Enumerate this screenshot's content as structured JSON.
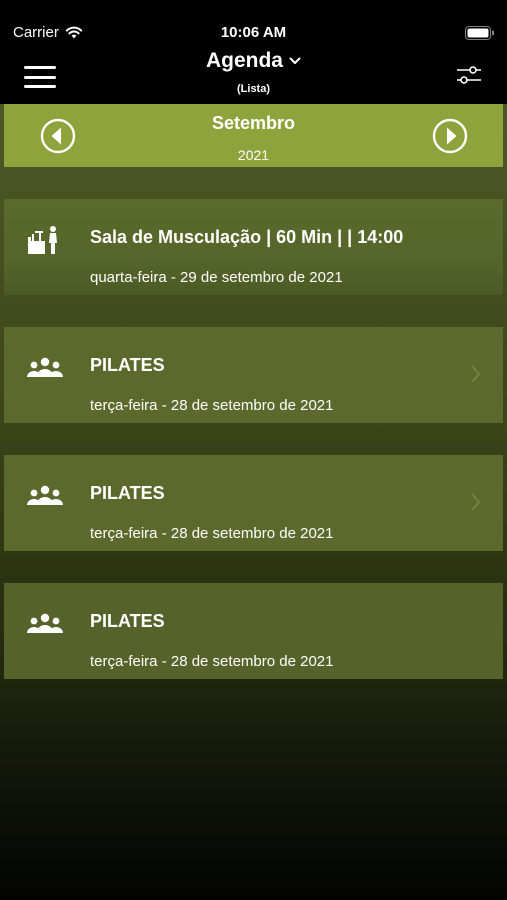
{
  "status": {
    "carrier": "Carrier",
    "time": "10:06 AM",
    "wifi_icon": "wifi-icon",
    "battery_icon": "battery-icon"
  },
  "nav": {
    "title": "Agenda",
    "subtitle": "(Lista)",
    "menu_icon": "hamburger-menu-icon",
    "filter_icon": "sliders-icon",
    "dropdown_icon": "chevron-down-icon"
  },
  "month": {
    "name": "Setembro",
    "year": "2021",
    "prev_icon": "arrow-left-circle-icon",
    "next_icon": "arrow-right-circle-icon"
  },
  "colors": {
    "accent": "#8fa33d",
    "card": "#5b6a2c",
    "header": "#000000"
  },
  "events": [
    {
      "icon": "gym-weights-icon",
      "title": "Sala de Musculação | 60 Min |  | 14:00",
      "date": "quarta-feira - 29 de setembro de 2021",
      "has_chevron": false
    },
    {
      "icon": "group-people-icon",
      "title": "PILATES",
      "date": "terça-feira - 28 de setembro de 2021",
      "has_chevron": true
    },
    {
      "icon": "group-people-icon",
      "title": "PILATES",
      "date": "terça-feira - 28 de setembro de 2021",
      "has_chevron": true
    },
    {
      "icon": "group-people-icon",
      "title": "PILATES",
      "date": "terça-feira - 28 de setembro de 2021",
      "has_chevron": false
    }
  ]
}
